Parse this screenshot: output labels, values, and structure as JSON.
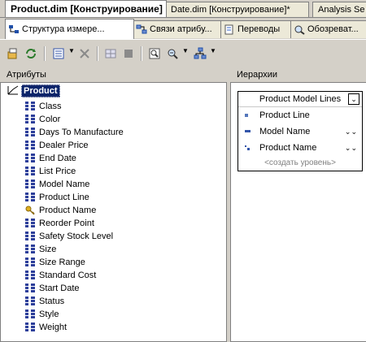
{
  "doc_tabs": [
    {
      "label": "Product.dim [Конструирование]",
      "active": true
    },
    {
      "label": "Date.dim [Конструирование]*",
      "active": false
    },
    {
      "label": "Analysis Se",
      "active": false
    }
  ],
  "designer_tabs": [
    {
      "label": "Структура измере...",
      "icon": "dimension-structure-icon",
      "active": true
    },
    {
      "label": "Связи атрибу...",
      "icon": "attribute-relationships-icon",
      "active": false
    },
    {
      "label": "Переводы",
      "icon": "translations-icon",
      "active": false
    },
    {
      "label": "Обозреват...",
      "icon": "browser-icon",
      "active": false
    }
  ],
  "toolbar": {
    "icons": [
      "process-icon",
      "refresh-icon",
      "view-icon",
      "delete-icon",
      "grid-icon",
      "stop-icon",
      "zoom-fit-icon",
      "zoom-icon",
      "layout-icon"
    ]
  },
  "attributes_pane": {
    "title": "Атрибуты",
    "root": "Product",
    "items": [
      {
        "label": "Class",
        "key": false
      },
      {
        "label": "Color",
        "key": false
      },
      {
        "label": "Days To Manufacture",
        "key": false
      },
      {
        "label": "Dealer Price",
        "key": false
      },
      {
        "label": "End Date",
        "key": false
      },
      {
        "label": "List Price",
        "key": false
      },
      {
        "label": "Model Name",
        "key": false
      },
      {
        "label": "Product Line",
        "key": false
      },
      {
        "label": "Product Name",
        "key": true
      },
      {
        "label": "Reorder Point",
        "key": false
      },
      {
        "label": "Safety Stock Level",
        "key": false
      },
      {
        "label": "Size",
        "key": false
      },
      {
        "label": "Size Range",
        "key": false
      },
      {
        "label": "Standard Cost",
        "key": false
      },
      {
        "label": "Start Date",
        "key": false
      },
      {
        "label": "Status",
        "key": false
      },
      {
        "label": "Style",
        "key": false
      },
      {
        "label": "Weight",
        "key": false
      }
    ]
  },
  "hierarchies_pane": {
    "title": "Иерархии",
    "hierarchy": {
      "name": "Product Model Lines",
      "levels": [
        {
          "label": "Product Line",
          "chevron": false
        },
        {
          "label": "Model Name",
          "chevron": true
        },
        {
          "label": "Product Name",
          "chevron": true
        }
      ],
      "new_level": "<создать уровень>"
    }
  }
}
